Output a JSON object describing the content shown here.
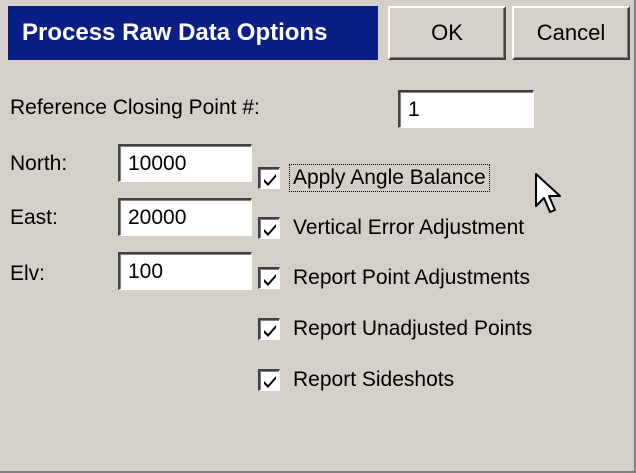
{
  "dialog": {
    "title": "Process Raw Data Options",
    "ok_label": "OK",
    "cancel_label": "Cancel"
  },
  "reference": {
    "label": "Reference Closing Point #:",
    "value": "1"
  },
  "coords": {
    "north_label": "North:",
    "north_value": "10000",
    "east_label": "East:",
    "east_value": "20000",
    "elv_label": "Elv:",
    "elv_value": "100"
  },
  "options": [
    {
      "label": "Apply Angle Balance",
      "checked": true
    },
    {
      "label": "Vertical Error Adjustment",
      "checked": true
    },
    {
      "label": "Report Point Adjustments",
      "checked": true
    },
    {
      "label": "Report Unadjusted Points",
      "checked": true
    },
    {
      "label": "Report Sideshots",
      "checked": true
    }
  ],
  "colors": {
    "titlebar": "#0a1f86",
    "face": "#d4d0c8"
  },
  "icons": {
    "checkmark": "checkmark-icon",
    "cursor": "mouse-pointer-icon"
  }
}
